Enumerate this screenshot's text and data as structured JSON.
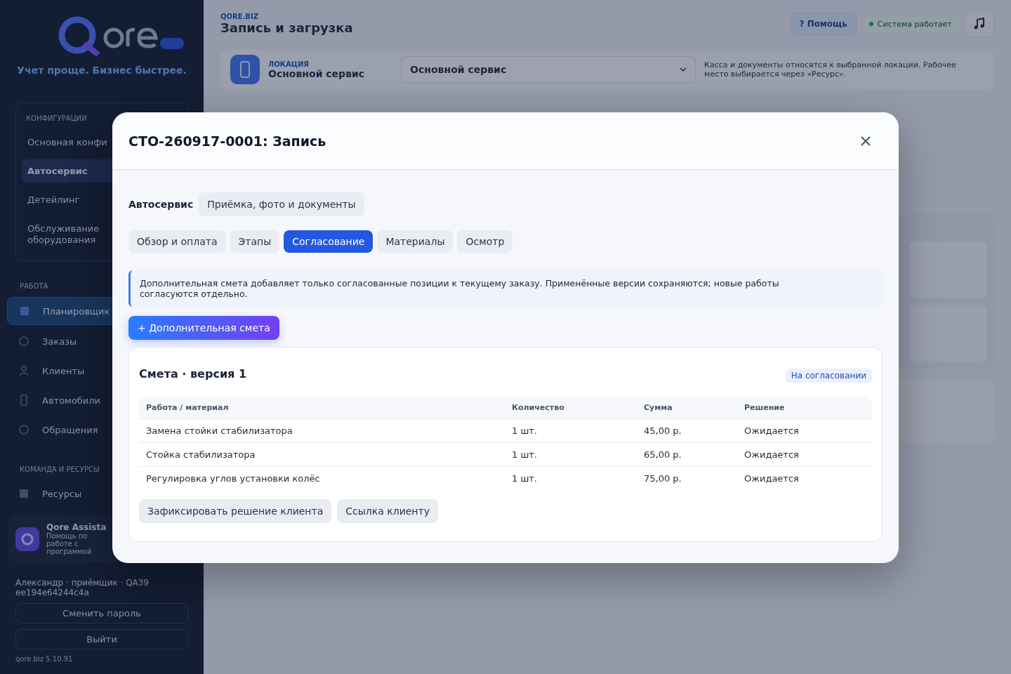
{
  "sidebar": {
    "tagline": "Учет проще. Бизнес быстрее.",
    "configs": {
      "title": "КОНФИГУРАЦИИ",
      "items": [
        {
          "label": "Основная конфи",
          "selected": false
        },
        {
          "label": "Автосервис",
          "selected": true
        },
        {
          "label": "Детейлинг",
          "selected": false
        },
        {
          "label": "Обслуживание оборудования",
          "selected": false
        }
      ]
    },
    "nav_groups": [
      {
        "title": "РАБОТА",
        "items": [
          {
            "label": "Планировщик",
            "selected": true
          },
          {
            "label": "Заказы",
            "selected": false
          },
          {
            "label": "Клиенты",
            "selected": false
          },
          {
            "label": "Автомобили",
            "selected": false
          },
          {
            "label": "Обращения",
            "selected": false
          }
        ]
      },
      {
        "title": "КОМАНДА И РЕСУРСЫ",
        "items": [
          {
            "label": "Ресурсы",
            "selected": false
          }
        ]
      }
    ],
    "assistant": {
      "title": "Qore Assista",
      "subtitle": "Помощь по работе с программой"
    },
    "user": "Александр · приёмщик · QA39 ee194e64244c4a",
    "buttons": [
      "Сменить пароль",
      "Выйти"
    ],
    "version": "qore.biz 5.10.91"
  },
  "header": {
    "eyebrow": "QORE.BIZ",
    "title": "Запись и загрузка",
    "help_button": "? Помощь",
    "status": "Система работает"
  },
  "location": {
    "label": "ЛОКАЦИЯ",
    "name": "Основной сервис",
    "select_value": "Основной сервис",
    "note": "Касса и документы относятся к выбранной локации. Рабочее место выбирается через «Ресурс»."
  },
  "modal": {
    "title": "СТО-260917-0001: Запись",
    "section_label": "Автосервис",
    "section_chip": "Приёмка, фото и документы",
    "tabs": [
      {
        "label": "Обзор и оплата",
        "selected": false
      },
      {
        "label": "Этапы",
        "selected": false
      },
      {
        "label": "Согласование",
        "selected": true
      },
      {
        "label": "Материалы",
        "selected": false
      },
      {
        "label": "Осмотр",
        "selected": false
      }
    ],
    "notice": "Дополнительная смета добавляет только согласованные позиции к текущему заказу. Применённые версии сохраняются; новые работы согласуются отдельно.",
    "add_button": "+ Дополнительная смета",
    "estimate": {
      "title": "Смета · версия 1",
      "status": "На согласовании",
      "columns": [
        "Работа / материал",
        "Количество",
        "Сумма",
        "Решение"
      ],
      "rows": [
        [
          "Замена стойки стабилизатора",
          "1 шт.",
          "45,00 р.",
          "Ожидается"
        ],
        [
          "Стойка стабилизатора",
          "1 шт.",
          "65,00 р.",
          "Ожидается"
        ],
        [
          "Регулировка углов установки колёс",
          "1 шт.",
          "75,00 р.",
          "Ожидается"
        ]
      ],
      "actions": [
        "Зафиксировать решение клиента",
        "Ссылка клиенту"
      ]
    }
  }
}
